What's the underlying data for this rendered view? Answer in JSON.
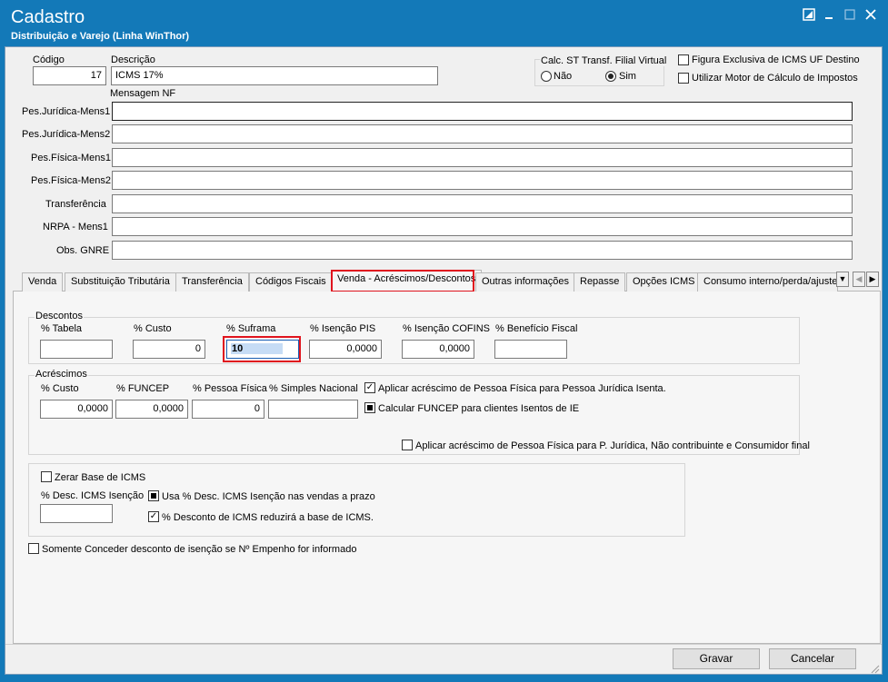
{
  "window": {
    "title": "Cadastro",
    "subtitle": "Distribuição e Varejo (Linha WinThor)",
    "controls": [
      "resize-icon",
      "minimize-icon",
      "maximize-icon",
      "close-icon"
    ]
  },
  "header": {
    "codigo_label": "Código",
    "codigo_value": "17",
    "descricao_label": "Descrição",
    "descricao_value": "ICMS 17%",
    "mensagem_nf_label": "Mensagem NF",
    "calc_st": {
      "label": "Calc. ST Transf. Filial Virtual",
      "option_nao": "Não",
      "option_sim": "Sim",
      "selected": "Sim"
    },
    "figura_exclusiva_label": "Figura Exclusiva de ICMS UF Destino",
    "figura_exclusiva_checked": false,
    "utilizar_motor_label": "Utilizar Motor de Cálculo de Impostos",
    "utilizar_motor_checked": false
  },
  "messages": {
    "pj_mens1_label": "Pes.Jurídica-Mens1",
    "pj_mens2_label": "Pes.Jurídica-Mens2",
    "pf_mens1_label": "Pes.Física-Mens1",
    "pf_mens2_label": "Pes.Física-Mens2",
    "transferencia_label": "Transferência",
    "nrpa_label": "NRPA - Mens1",
    "obs_gnre_label": "Obs. GNRE"
  },
  "tabs": {
    "t0": "Venda",
    "t1": "Substituição Tributária",
    "t2": "Transferência",
    "t3": "Códigos Fiscais",
    "t4": "Venda - Acréscimos/Descontos",
    "t5": "Outras informações",
    "t6": "Repasse",
    "t7": "Opções ICMS",
    "t8": "Consumo interno/perda/ajuste",
    "active": "Venda - Acréscimos/Descontos"
  },
  "descontos": {
    "group_label": "Descontos",
    "tabela_label": "% Tabela",
    "tabela_value": "",
    "custo_label": "% Custo",
    "custo_value": "0",
    "suframa_label": "% Suframa",
    "suframa_value": "10",
    "isencao_pis_label": "% Isenção PIS",
    "isencao_pis_value": "0,0000",
    "isencao_cofins_label": "% Isenção COFINS",
    "isencao_cofins_value": "0,0000",
    "beneficio_fiscal_label": "% Benefício Fiscal",
    "beneficio_fiscal_value": ""
  },
  "acrescimos": {
    "group_label": "Acréscimos",
    "custo_label": "% Custo",
    "custo_value": "0,0000",
    "funcep_label": "% FUNCEP",
    "funcep_value": "0,0000",
    "pessoa_fisica_label": "% Pessoa Física",
    "pessoa_fisica_value": "0",
    "simples_nacional_label": "% Simples Nacional",
    "simples_nacional_value": "",
    "aplicar_pf_pj_label": "Aplicar acréscimo de Pessoa Física para Pessoa Jurídica Isenta.",
    "aplicar_pf_pj_checked": true,
    "calcular_funcep_label": "Calcular FUNCEP para clientes Isentos de IE",
    "calcular_funcep_state": "indeterminate",
    "aplicar_pf_nc_label": "Aplicar acréscimo de Pessoa Física para P. Jurídica, Não contribuinte e Consumidor final",
    "aplicar_pf_nc_checked": false
  },
  "icms": {
    "zerar_base_label": "Zerar Base de ICMS",
    "zerar_base_checked": false,
    "desc_isencao_label": "% Desc. ICMS Isenção",
    "desc_isencao_value": "",
    "usa_desc_label": "Usa % Desc. ICMS Isenção nas vendas a prazo",
    "usa_desc_state": "indeterminate",
    "reduz_base_label": "% Desconto de ICMS reduzirá a base de ICMS.",
    "reduz_base_checked": true
  },
  "empenho": {
    "label": "Somente Conceder desconto de isenção se Nº Empenho for informado",
    "checked": false
  },
  "footer": {
    "gravar_label": "Gravar",
    "cancelar_label": "Cancelar"
  },
  "colors": {
    "titlebar": "#1379b8",
    "highlight": "#e0141e",
    "selection": "#c6dcf5"
  }
}
